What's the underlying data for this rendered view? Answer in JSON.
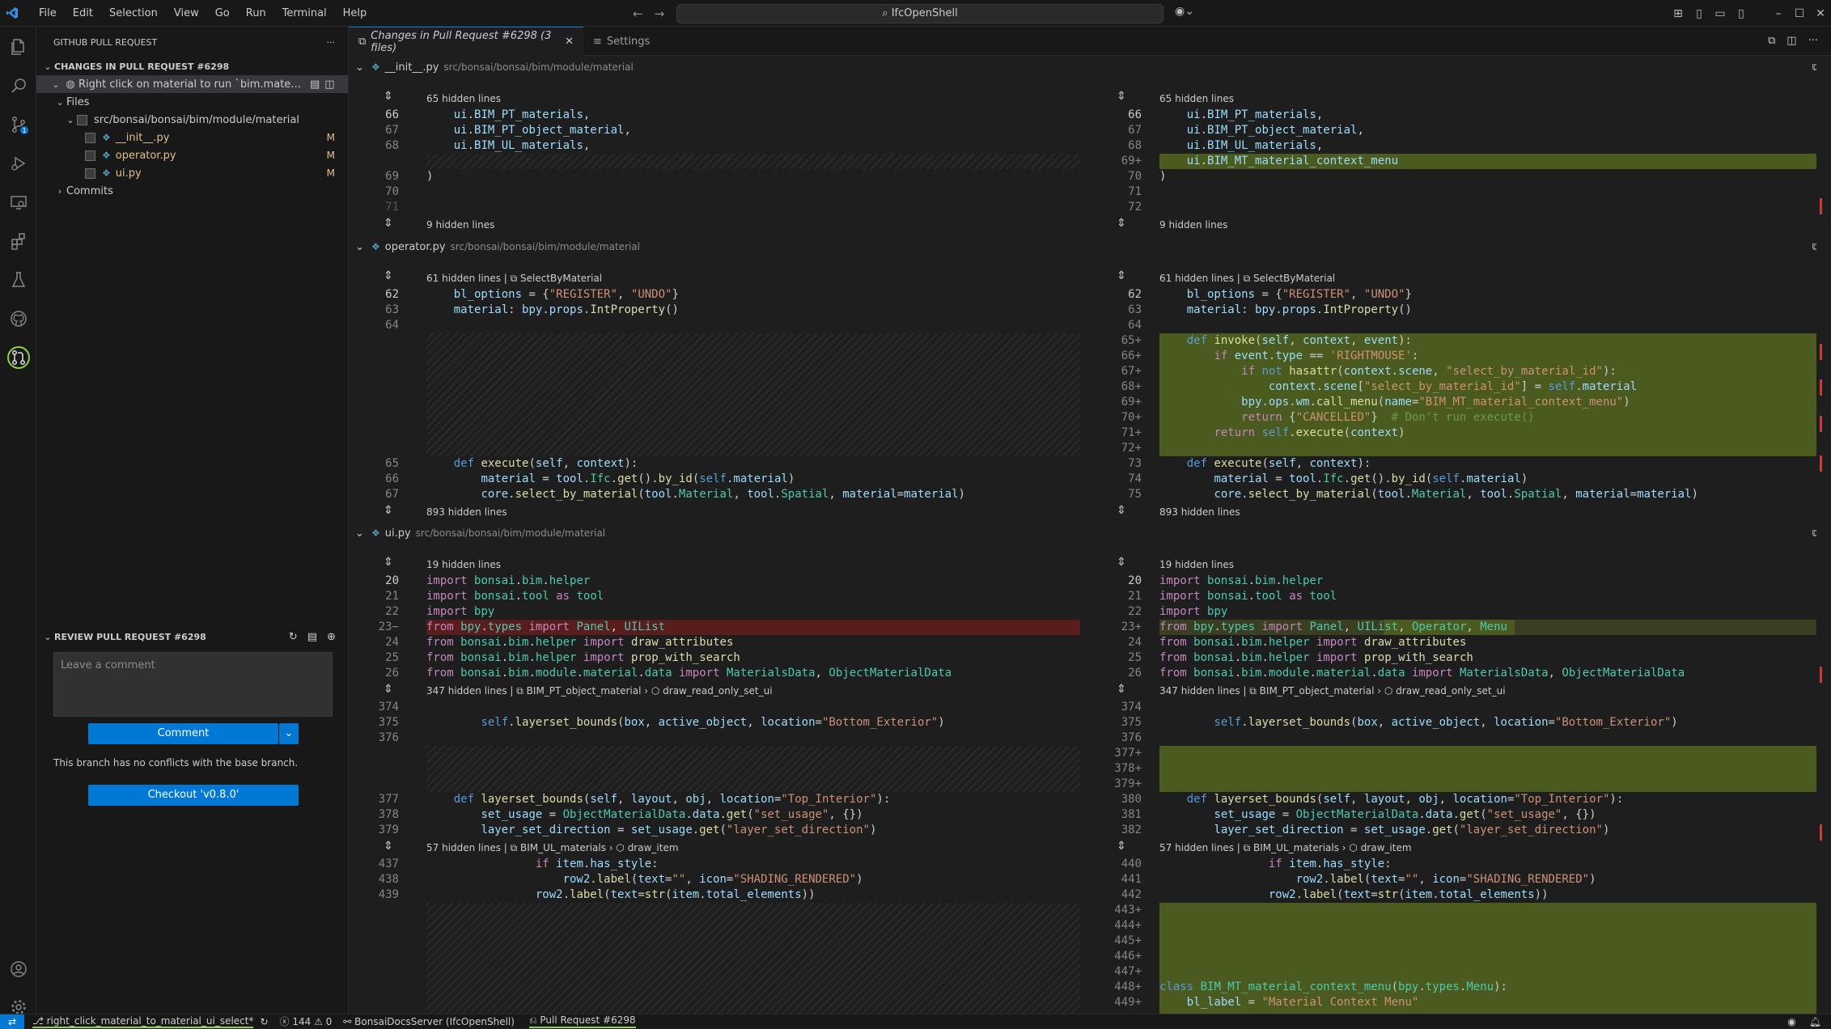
{
  "titlebar": {
    "menus": [
      "File",
      "Edit",
      "Selection",
      "View",
      "Go",
      "Run",
      "Terminal",
      "Help"
    ],
    "search": "IfcOpenShell"
  },
  "sidebar": {
    "header": "GITHUB PULL REQUEST",
    "section": "CHANGES IN PULL REQUEST #6298",
    "pr_item": "Right click on material to run `bim.material_ui...",
    "files_label": "Files",
    "folder": "src/bonsai/bonsai/bim/module/material",
    "files": [
      {
        "name": "__init__.py",
        "status": "M"
      },
      {
        "name": "operator.py",
        "status": "M"
      },
      {
        "name": "ui.py",
        "status": "M"
      }
    ],
    "commits": "Commits",
    "review_title": "REVIEW PULL REQUEST #6298",
    "comment_placeholder": "Leave a comment",
    "comment_button": "Comment",
    "no_conflicts": "This branch has no conflicts with the base branch.",
    "checkout_button": "Checkout 'v0.8.0'"
  },
  "tabs": [
    {
      "label": "Changes in Pull Request #6298 (3 files)",
      "active": true
    },
    {
      "label": "Settings",
      "active": false
    }
  ],
  "files": [
    {
      "name": "__init__.py",
      "path": "src/bonsai/bonsai/bim/module/material"
    },
    {
      "name": "operator.py",
      "path": "src/bonsai/bonsai/bim/module/material"
    },
    {
      "name": "ui.py",
      "path": "src/bonsai/bonsai/bim/module/material"
    }
  ],
  "hidden": {
    "h65": "65 hidden lines",
    "h9": "9 hidden lines",
    "h61": "61 hidden lines",
    "h893": "893 hidden lines",
    "h19": "19 hidden lines",
    "h347": "347 hidden lines",
    "h57": "57 hidden lines",
    "sym_select": "SelectByMaterial",
    "sym_pt": "BIM_PT_object_material",
    "sym_draw_ro": "draw_read_only_set_ui",
    "sym_ul": "BIM_UL_materials",
    "sym_draw_item": "draw_item"
  },
  "statusbar": {
    "branch": "right_click_material_to_material_ui_select*",
    "problems": "ⓧ 144 ⚠ 0",
    "server": "BonsaiDocsServer (IfcOpenShell)",
    "pr": "Pull Request #6298"
  },
  "colors": {
    "accent": "#0078d4",
    "added": "#4b5a1e",
    "removed": "#5a1d1d"
  }
}
